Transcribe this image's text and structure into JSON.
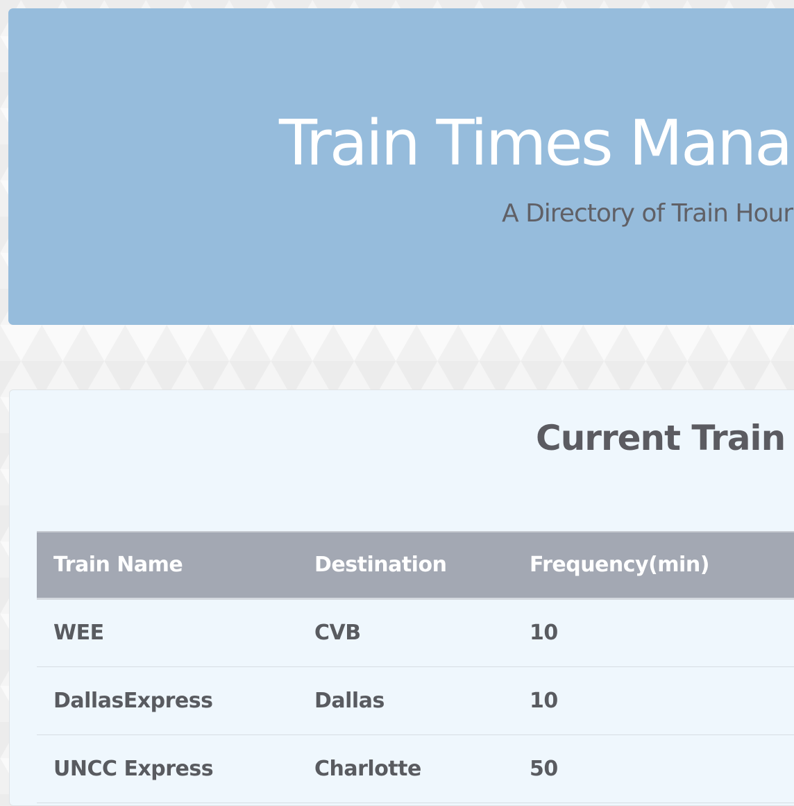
{
  "jumbotron": {
    "title": "Train Times Mana",
    "subtitle": "A Directory of Train Hour"
  },
  "panel": {
    "title": "Current Train"
  },
  "table": {
    "headers": [
      "Train Name",
      "Destination",
      "Frequency(min)"
    ],
    "rows": [
      [
        "WEE",
        "CVB",
        "10"
      ],
      [
        "DallasExpress",
        "Dallas",
        "10"
      ],
      [
        "UNCC Express",
        "Charlotte",
        "50"
      ]
    ]
  },
  "colors": {
    "jumbotron_background": "#96bcdc",
    "panel_background": "#eff7fd",
    "table_header_background": "#a3a8b3",
    "heading_text": "#5b5b61"
  }
}
